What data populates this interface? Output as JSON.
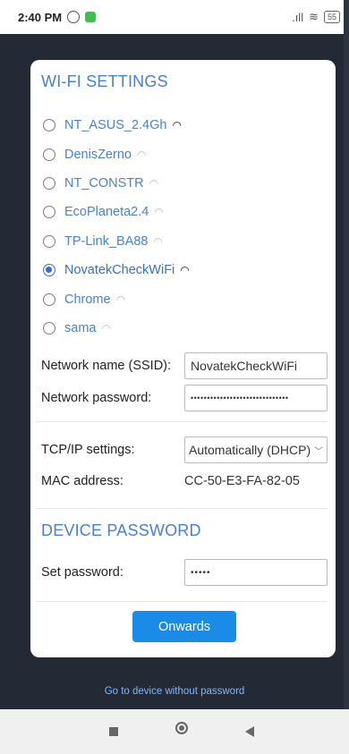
{
  "status": {
    "time": "2:40 PM",
    "battery": "55"
  },
  "wifi": {
    "title": "WI-FI SETTINGS",
    "networks": [
      {
        "ssid": "NT_ASUS_2.4Gh",
        "signal": "strong",
        "selected": false
      },
      {
        "ssid": "DenisZerno",
        "signal": "weak",
        "selected": false
      },
      {
        "ssid": "NT_CONSTR",
        "signal": "weak",
        "selected": false
      },
      {
        "ssid": "EcoPlaneta2.4",
        "signal": "weak",
        "selected": false
      },
      {
        "ssid": "TP-Link_BA88",
        "signal": "weak",
        "selected": false
      },
      {
        "ssid": "NovatekCheckWiFi",
        "signal": "strong",
        "selected": true
      },
      {
        "ssid": "Chrome",
        "signal": "weak",
        "selected": false
      },
      {
        "ssid": "sama",
        "signal": "weak",
        "selected": false
      }
    ],
    "ssid_label": "Network name (SSID):",
    "ssid_value": "NovatekCheckWiFi",
    "password_label": "Network password:",
    "password_value": "••••••••••••••••••••••••••••••",
    "tcpip_label": "TCP/IP settings:",
    "tcpip_value": "Automatically (DHCP)",
    "mac_label": "MAC address:",
    "mac_value": "CC-50-E3-FA-82-05"
  },
  "device": {
    "title": "DEVICE PASSWORD",
    "set_password_label": "Set password:",
    "set_password_value": "•••••"
  },
  "actions": {
    "onwards": "Onwards",
    "go_without_password": "Go to device without password"
  },
  "colors": {
    "accent": "#4a82c8",
    "button": "#1a8ce8",
    "background": "#232a35"
  }
}
